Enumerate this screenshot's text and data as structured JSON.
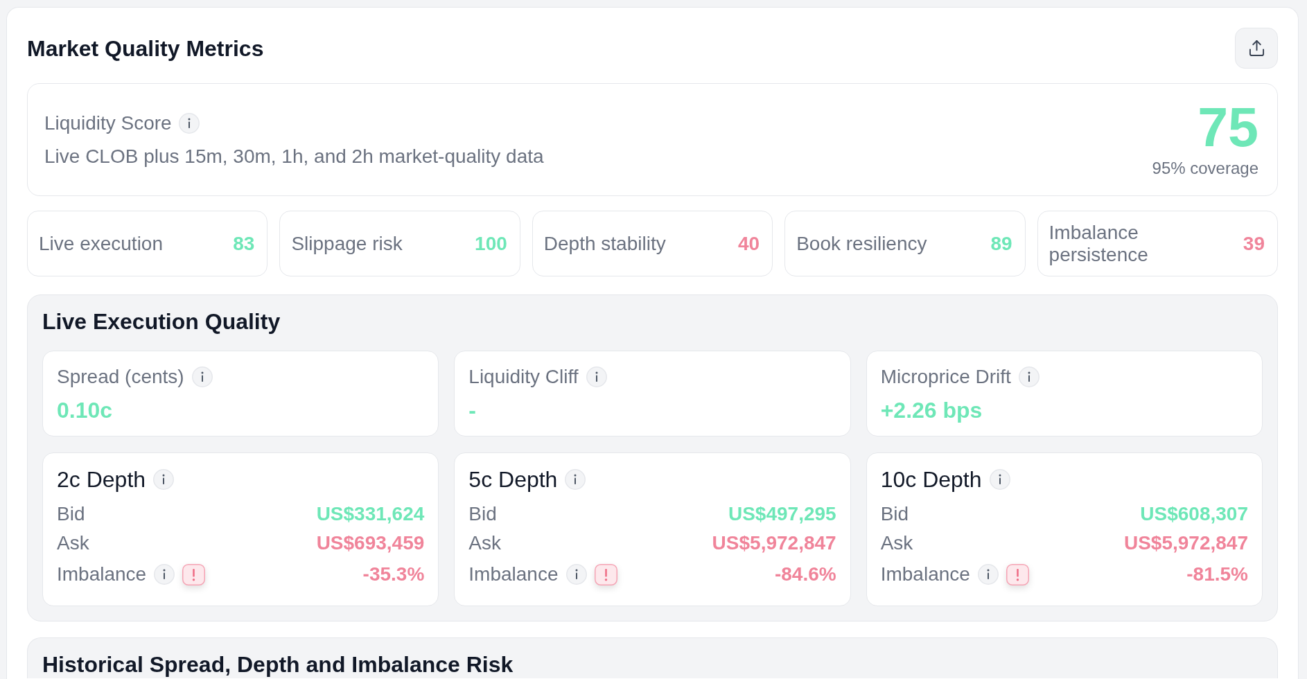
{
  "header": {
    "title": "Market Quality Metrics"
  },
  "liquidity_score": {
    "label": "Liquidity Score",
    "description": "Live CLOB plus 15m, 30m, 1h, and 2h market-quality data",
    "score": "75",
    "coverage": "95% coverage"
  },
  "metrics": [
    {
      "label": "Live execution",
      "value": "83",
      "color": "#6ee7b7"
    },
    {
      "label": "Slippage risk",
      "value": "100",
      "color": "#6ee7b7"
    },
    {
      "label": "Depth stability",
      "value": "40",
      "color": "#f0849a"
    },
    {
      "label": "Book resiliency",
      "value": "89",
      "color": "#6ee7b7"
    },
    {
      "label": "Imbalance persistence",
      "value": "39",
      "color": "#f0849a"
    }
  ],
  "live_execution_quality": {
    "title": "Live Execution Quality",
    "stats": [
      {
        "label": "Spread (cents)",
        "value": "0.10c",
        "color": "#6ee7b7"
      },
      {
        "label": "Liquidity Cliff",
        "value": "-",
        "color": "#6ee7b7"
      },
      {
        "label": "Microprice Drift",
        "value": "+2.26 bps",
        "color": "#6ee7b7"
      }
    ],
    "depth": [
      {
        "title": "2c Depth",
        "rows": [
          {
            "kind": "amount",
            "label": "Bid",
            "value": "US$331,624",
            "color": "#6ee7b7",
            "warning": false
          },
          {
            "kind": "amount",
            "label": "Ask",
            "value": "US$693,459",
            "color": "#f0849a",
            "warning": false
          },
          {
            "kind": "imbalance",
            "label": "Imbalance",
            "value": "-35.3%",
            "color": "#f0849a",
            "warning": true
          }
        ]
      },
      {
        "title": "5c Depth",
        "rows": [
          {
            "kind": "amount",
            "label": "Bid",
            "value": "US$497,295",
            "color": "#6ee7b7",
            "warning": false
          },
          {
            "kind": "amount",
            "label": "Ask",
            "value": "US$5,972,847",
            "color": "#f0849a",
            "warning": false
          },
          {
            "kind": "imbalance",
            "label": "Imbalance",
            "value": "-84.6%",
            "color": "#f0849a",
            "warning": true
          }
        ]
      },
      {
        "title": "10c Depth",
        "rows": [
          {
            "kind": "amount",
            "label": "Bid",
            "value": "US$608,307",
            "color": "#6ee7b7",
            "warning": false
          },
          {
            "kind": "amount",
            "label": "Ask",
            "value": "US$5,972,847",
            "color": "#f0849a",
            "warning": false
          },
          {
            "kind": "imbalance",
            "label": "Imbalance",
            "value": "-81.5%",
            "color": "#f0849a",
            "warning": true
          }
        ]
      }
    ]
  },
  "historical": {
    "title": "Historical Spread, Depth and Imbalance Risk"
  }
}
